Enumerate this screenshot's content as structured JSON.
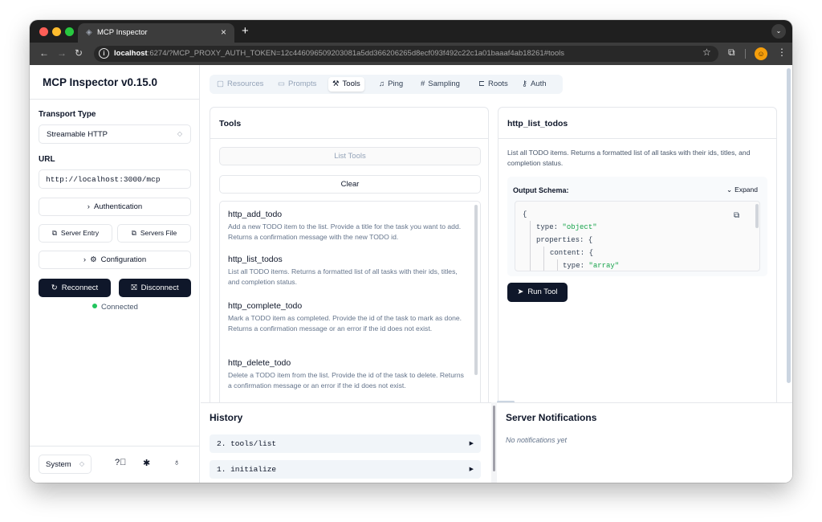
{
  "browser": {
    "tab_title": "MCP Inspector",
    "tab_close": "×",
    "new_tab": "+",
    "url_host": "localhost",
    "url_rest": ":6274/?MCP_PROXY_AUTH_TOKEN=12c446096509203081a5dd366206265d8ecf093f492c22c1a01baaaf4ab18261#tools"
  },
  "sidebar": {
    "title": "MCP Inspector v0.15.0",
    "transport_label": "Transport Type",
    "transport_value": "Streamable HTTP",
    "url_label": "URL",
    "url_value": "http://localhost:3000/mcp",
    "authentication": "Authentication",
    "server_entry": "Server Entry",
    "servers_file": "Servers File",
    "configuration": "Configuration",
    "reconnect": "Reconnect",
    "disconnect": "Disconnect",
    "status": "Connected",
    "status_color": "#22c55e",
    "theme": "System"
  },
  "tabs": [
    {
      "label": "Resources",
      "icon": "resources-icon",
      "state": "disabled"
    },
    {
      "label": "Prompts",
      "icon": "prompts-icon",
      "state": "disabled"
    },
    {
      "label": "Tools",
      "icon": "tools-icon",
      "state": "active"
    },
    {
      "label": "Ping",
      "icon": "bell-icon",
      "state": "enabled"
    },
    {
      "label": "Sampling",
      "icon": "hash-icon",
      "state": "enabled"
    },
    {
      "label": "Roots",
      "icon": "folder-tree-icon",
      "state": "enabled"
    },
    {
      "label": "Auth",
      "icon": "key-icon",
      "state": "enabled"
    }
  ],
  "tools_panel": {
    "title": "Tools",
    "list_tools": "List Tools",
    "clear": "Clear",
    "items": [
      {
        "name": "http_add_todo",
        "description": "Add a new TODO item to the list. Provide a title for the task you want to add. Returns a confirmation message with the new TODO id."
      },
      {
        "name": "http_list_todos",
        "description": "List all TODO items. Returns a formatted list of all tasks with their ids, titles, and completion status."
      },
      {
        "name": "http_complete_todo",
        "description": "Mark a TODO item as completed. Provide the id of the task to mark as done. Returns a confirmation message or an error if the id does not exist."
      },
      {
        "name": "http_delete_todo",
        "description": "Delete a TODO item from the list. Provide the id of the task to delete. Returns a confirmation message or an error if the id does not exist."
      }
    ]
  },
  "detail_panel": {
    "title": "http_list_todos",
    "description": "List all TODO items. Returns a formatted list of all tasks with their ids, titles, and completion status.",
    "schema_label": "Output Schema:",
    "expand": "Expand",
    "code": {
      "open": "{",
      "type_key": "type:",
      "type_val": "\"object\"",
      "props_key": "properties: {",
      "content_key": "content: {",
      "type2_key": "type:",
      "type2_val": "\"array\""
    },
    "run_tool": "Run Tool"
  },
  "history": {
    "title": "History",
    "items": [
      "2. tools/list",
      "1. initialize"
    ],
    "arrow": "▶"
  },
  "notifications": {
    "title": "Server Notifications",
    "empty": "No notifications yet"
  }
}
